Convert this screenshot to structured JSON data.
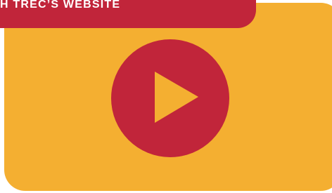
{
  "banner": {
    "text": "H TREC’S WEBSITE"
  },
  "colors": {
    "card_background": "#f4af31",
    "banner_background": "#c1253a",
    "play_circle": "#c1253a",
    "play_triangle": "#f4af31",
    "banner_text": "#ffffff"
  },
  "player": {
    "icon": "play-icon"
  }
}
